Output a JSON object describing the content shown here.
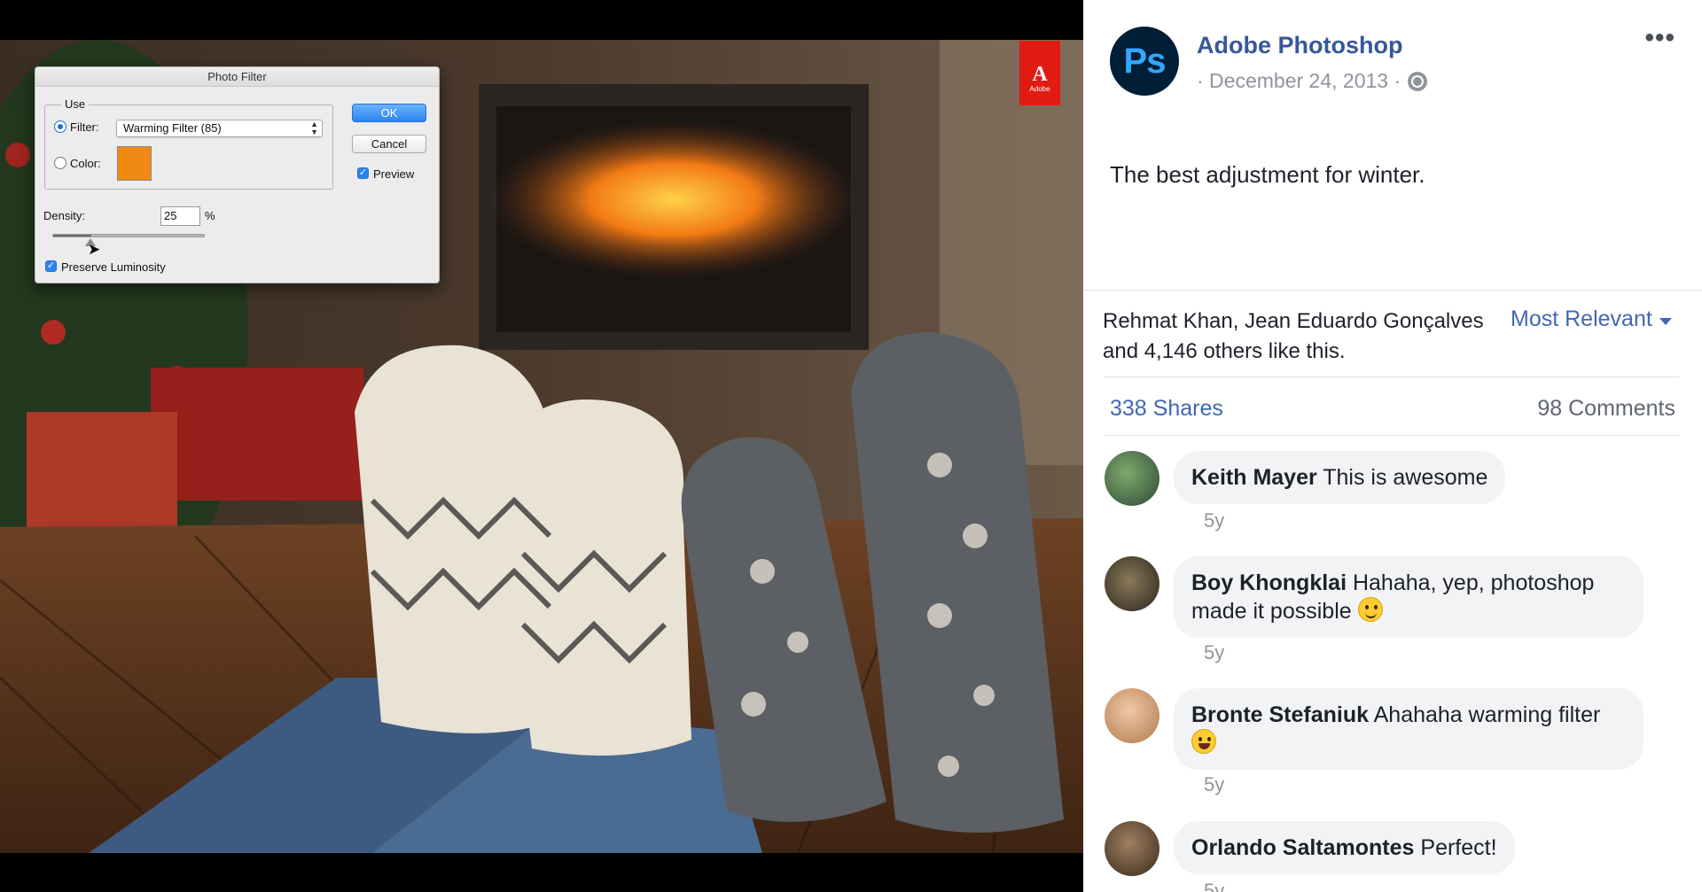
{
  "media": {
    "adobe_badge": {
      "glyph": "A",
      "word": "Adobe"
    },
    "dialog": {
      "title": "Photo Filter",
      "use_label": "Use",
      "filter_label": "Filter:",
      "filter_value": "Warming Filter (85)",
      "color_label": "Color:",
      "color_swatch": "#f08a12",
      "ok_label": "OK",
      "cancel_label": "Cancel",
      "preview_label": "Preview",
      "density_label": "Density:",
      "density_value": "25",
      "density_unit": "%",
      "density_level": 0.25,
      "preserve_label": "Preserve Luminosity"
    }
  },
  "post": {
    "avatar_text": "Ps",
    "page_name": "Adobe Photoshop",
    "date": "· December 24, 2013 ·",
    "more": "•••",
    "text": "The best adjustment for winter.",
    "likes_text": "Rehmat Khan, Jean Eduardo Gonçalves and 4,146 others like this.",
    "sort_label": "Most Relevant",
    "shares": "338 Shares",
    "comments_count": "98 Comments",
    "comments": [
      {
        "author": "Keith Mayer",
        "text": "This is awesome",
        "time": "5y",
        "emoji": ""
      },
      {
        "author": "Boy Khongklai",
        "text": "Hahaha, yep, photoshop made it possible",
        "time": "5y",
        "emoji": "smile"
      },
      {
        "author": "Bronte Stefaniuk",
        "text": "Ahahaha warming filter",
        "time": "5y",
        "emoji": "grin"
      },
      {
        "author": "Orlando Saltamontes",
        "text": "Perfect!",
        "time": "5y",
        "emoji": ""
      }
    ]
  },
  "colors": {
    "link": "#365899",
    "accent": "#4267b2",
    "muted": "#90949c",
    "bubble": "#f2f3f5",
    "adobe_red": "#e21b12"
  }
}
